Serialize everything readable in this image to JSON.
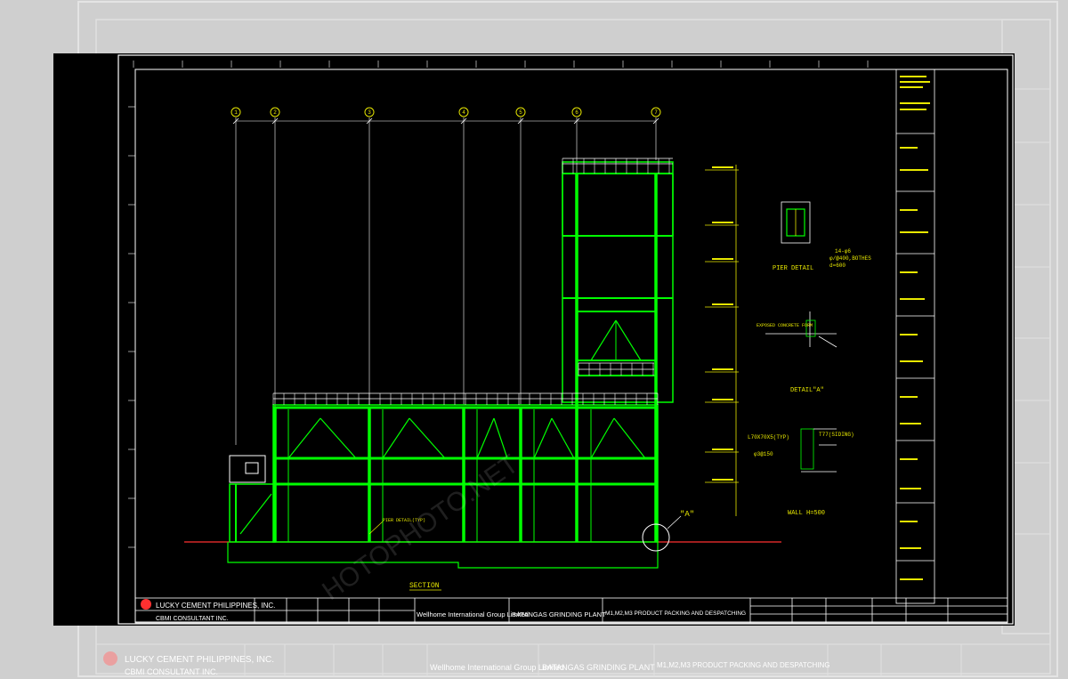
{
  "background_sheet": {
    "company": "LUCKY CEMENT PHILIPPINES, INC.",
    "consultant": "CBMI CONSULTANT INC.",
    "contractor": "Wellhome International Group Limited",
    "project": "BATANGAS GRINDING PLANT",
    "drawing_title": "M1,M2,M3 PRODUCT PACKING AND DESPATCHING"
  },
  "drawing": {
    "section_title": "SECTION",
    "grid_bubbles": [
      "1",
      "2",
      "3",
      "4",
      "5",
      "6",
      "7"
    ],
    "pier_detail_title": "PIER DETAIL",
    "detail_a_title": "DETAIL\"A\"",
    "detail_a_marker": "\"A\"",
    "pier_detail_typ": "PIER DETAIL(TYP)",
    "rebar_note": "14-φ6",
    "stirrup_note": "φ/@400,BOTHES",
    "d_note": "d=600",
    "angle_note": "L70X70X5(TYP)",
    "bolt_note": "φ3@150",
    "siding_note": "T77(SIDING)",
    "wall_note": "WALL H=500",
    "exposed_note": "EXPOSED CONCRETE FORM"
  },
  "title_block": {
    "company": "LUCKY CEMENT PHILIPPINES, INC.",
    "consultant": "CBMI CONSULTANT INC.",
    "contractor": "Wellhome International Group Limited",
    "project": "BATANGAS GRINDING PLANT",
    "drawing_title": "M1,M2,M3 PRODUCT PACKING AND DESPATCHING"
  },
  "watermark": "HOTOPHOTO.NET",
  "colors": {
    "structure": "#00ff00",
    "annotation": "#e8e800",
    "border": "#ffffff",
    "accent_red": "#ff3030",
    "cad_background": "#000000",
    "sheet_background": "#cfcfcf"
  }
}
